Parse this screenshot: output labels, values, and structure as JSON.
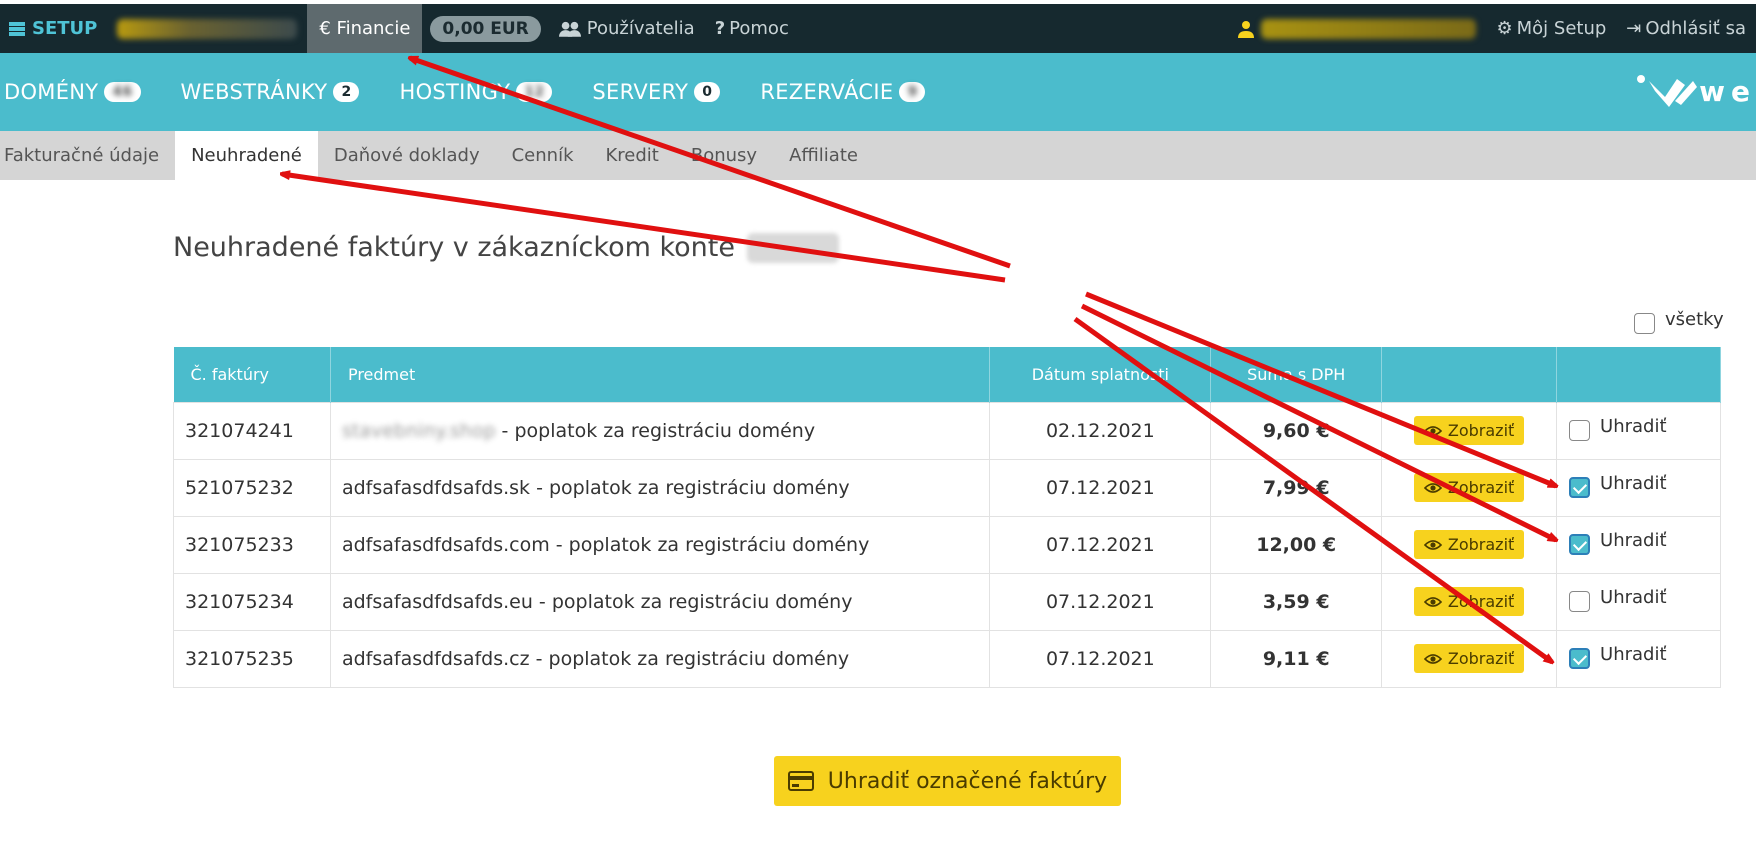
{
  "topbar": {
    "setup_label": "SETUP",
    "account_blurred": "Ing. Jozef Svaj",
    "financie_label": "€ Financie",
    "balance_badge": "0,00 EUR",
    "users_label": "Používatelia",
    "help_label": "Pomoc",
    "email_blurred": "webhouse@webhouse.sk",
    "my_setup_label": "Môj Setup",
    "logout_label": "Odhlásiť sa"
  },
  "bluenav": {
    "items": [
      {
        "label": "DOMÉNY",
        "badge": "46"
      },
      {
        "label": "WEBSTRÁNKY",
        "badge": "2"
      },
      {
        "label": "HOSTINGY",
        "badge": "12"
      },
      {
        "label": "SERVERY",
        "badge": "0"
      },
      {
        "label": "REZERVÁCIE",
        "badge": "9"
      }
    ],
    "logo_text": "we"
  },
  "subtabs": [
    "Fakturačné údaje",
    "Neuhradené",
    "Daňové doklady",
    "Cenník",
    "Kredit",
    "Bonusy",
    "Affiliate"
  ],
  "heading": "Neuhradené faktúry v zákazníckom konte",
  "select_all_label": "všetky",
  "table": {
    "headers": [
      "Č. faktúry",
      "Predmet",
      "Dátum splatnosti",
      "Suma s DPH",
      "",
      ""
    ],
    "view_label": "Zobraziť",
    "pay_label": "Uhradiť",
    "rows": [
      {
        "number": "321074241",
        "subject_blurred": "stavebniny.shop",
        "subject": " - poplatok za registráciu domény",
        "due": "02.12.2021",
        "amount": "9,60 €",
        "checked": false
      },
      {
        "number": "521075232",
        "subject_blurred": "",
        "subject": "adfsafasdfdsafds.sk - poplatok za registráciu domény",
        "due": "07.12.2021",
        "amount": "7,99 €",
        "checked": true
      },
      {
        "number": "321075233",
        "subject_blurred": "",
        "subject": "adfsafasdfdsafds.com - poplatok za registráciu domény",
        "due": "07.12.2021",
        "amount": "12,00 €",
        "checked": true
      },
      {
        "number": "321075234",
        "subject_blurred": "",
        "subject": "adfsafasdfdsafds.eu - poplatok za registráciu domény",
        "due": "07.12.2021",
        "amount": "3,59 €",
        "checked": false
      },
      {
        "number": "321075235",
        "subject_blurred": "",
        "subject": "adfsafasdfdsafds.cz - poplatok za registráciu domény",
        "due": "07.12.2021",
        "amount": "9,11 €",
        "checked": true
      }
    ]
  },
  "pay_button_label": "Uhradiť označené faktúry",
  "colors": {
    "accent": "#4bbccc",
    "button": "#f7d21e",
    "topbar": "#16292f",
    "annotation": "#e01010"
  }
}
